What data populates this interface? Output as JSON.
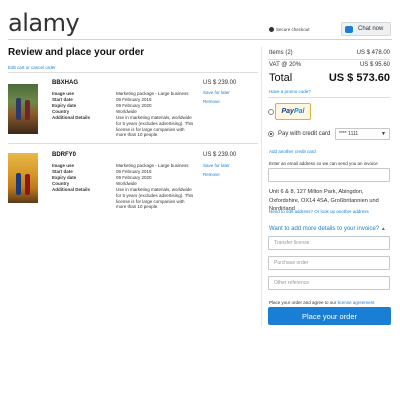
{
  "header": {
    "logo": "alamy",
    "secure_checkout": "Secure checkout",
    "chat_label": "Chat now"
  },
  "page": {
    "title": "Review and place your order",
    "edit_link": "Edit cart or cancel order"
  },
  "items": [
    {
      "code": "BBXHAG",
      "price": "US $ 239.00",
      "save_label": "Save for later",
      "remove_label": "Remove",
      "details": [
        {
          "k": "Image use",
          "v": "Marketing package - Large business"
        },
        {
          "k": "Start date",
          "v": "09 February 2015"
        },
        {
          "k": "Expiry date",
          "v": "09 February 2020"
        },
        {
          "k": "Country",
          "v": "Worldwide"
        },
        {
          "k": "Additional Details",
          "v": "Use in marketing materials, worldwide for 5 years (excludes advertising). This license is for large companies with more than 10 people."
        }
      ]
    },
    {
      "code": "BDRFY0",
      "price": "US $ 239.00",
      "save_label": "Save for later",
      "remove_label": "Remove",
      "details": [
        {
          "k": "Image use",
          "v": "Marketing package - Large business"
        },
        {
          "k": "Start date",
          "v": "09 February 2015"
        },
        {
          "k": "Expiry date",
          "v": "09 February 2020"
        },
        {
          "k": "Country",
          "v": "Worldwide"
        },
        {
          "k": "Additional Details",
          "v": "Use in marketing materials, worldwide for 5 years (excludes advertising). This license is for large companies with more than 10 people."
        }
      ]
    }
  ],
  "summary": {
    "items_label": "Items (2)",
    "items_value": "US $ 478.00",
    "vat_label": "VAT @ 20%",
    "vat_value": "US $ 95.60",
    "total_label": "Total",
    "total_value": "US $ 573.60",
    "promo_link": "Have a promo code?"
  },
  "payment": {
    "paypal_pay": "Pay",
    "paypal_pal": "Pal",
    "credit_card_label": "Pay with credit card",
    "card_selected": "**** 1111",
    "add_card_link": "Add another credit card",
    "paypal_selected": false,
    "credit_card_selected": true
  },
  "email": {
    "label": "Enter an email address so we can send you an invoice",
    "value": ""
  },
  "address": {
    "text": "Unit 6 & 8, 127 Milton Park, Abingdon, Oxfordshire, OX14 4SA, Großbritannien und Nordirland",
    "edit_link": "Need to edit address? Or look up another address"
  },
  "more_details": {
    "heading": "Want to add more details to your invoice?",
    "transfer_placeholder": "Transfer license",
    "purchase_placeholder": "Purchase order",
    "other_placeholder": "Other reference"
  },
  "agreement": {
    "text": "Place your order and agree to our",
    "link": "license agreement"
  },
  "place_order_label": "Place your order",
  "colors": {
    "accent": "#1a7fd4",
    "text": "#222222"
  }
}
